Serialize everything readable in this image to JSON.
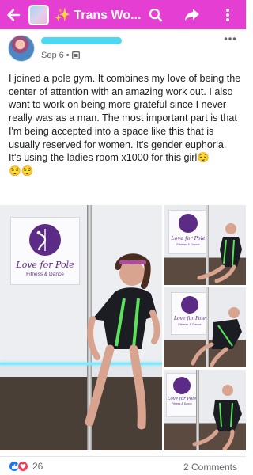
{
  "header": {
    "group_title": "Trans Wo...",
    "sparkle_emoji": "✨",
    "accent_color": "#e43fd2",
    "icons": [
      "back-arrow-icon",
      "search-icon",
      "share-icon",
      "more-vertical-icon"
    ]
  },
  "post": {
    "date": "Sep 6",
    "separator": "•",
    "audience_icon": "group-icon",
    "paragraphs": [
      "I joined a pole gym. It combines my love of being the center of attention with an amazing work out. I also want to work on being more grateful since I never really was as a man. The most important part is that I'm being accepted into a space like this that is usually reserved for women. It's gender euphoria.",
      "It's using the ladies room x1000 for this girl😌",
      "😌😌"
    ]
  },
  "photos": {
    "brand_name": "Love for Pole",
    "brand_sub": "Fitness & Dance"
  },
  "footer": {
    "reaction_count": "26",
    "comments_label": "2 Comments"
  }
}
